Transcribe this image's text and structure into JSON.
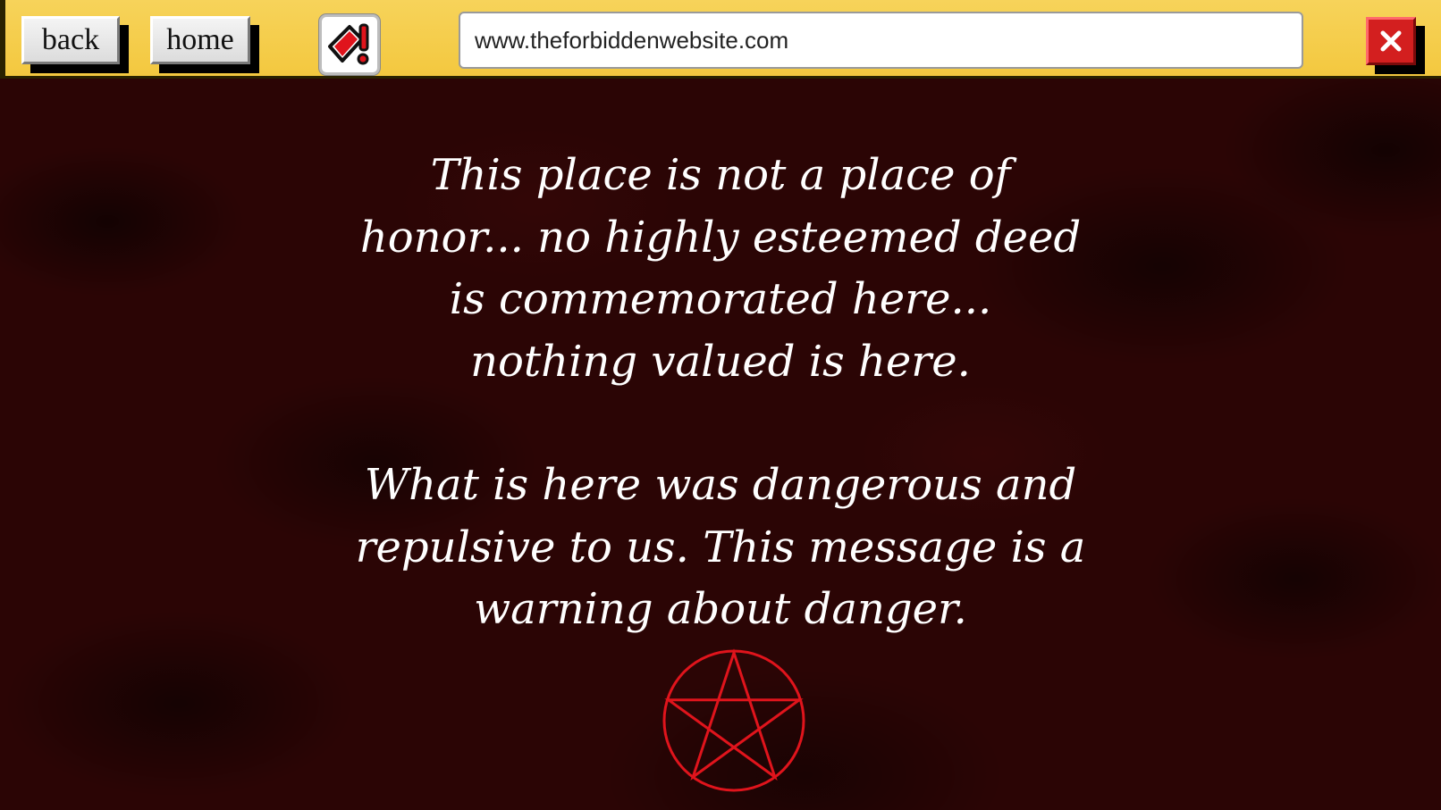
{
  "toolbar": {
    "back_label": "back",
    "home_label": "home",
    "url": "www.theforbiddenwebsite.com",
    "warning_icon": "warning-sign-icon",
    "close_icon": "close-icon"
  },
  "content": {
    "paragraph1_lines": [
      "This place is not a place of",
      "honor... no highly esteemed deed",
      "is commemorated here...",
      "nothing valued is here."
    ],
    "paragraph2_lines": [
      "What is here was dangerous and",
      "repulsive to us. This message is a",
      "warning about danger."
    ],
    "symbol_icon": "pentagram-icon"
  },
  "colors": {
    "toolbar": "#f3c83f",
    "background": "#2b0505",
    "text": "#ffffff",
    "pentagram": "#e0141c",
    "close": "#d31f1f"
  }
}
